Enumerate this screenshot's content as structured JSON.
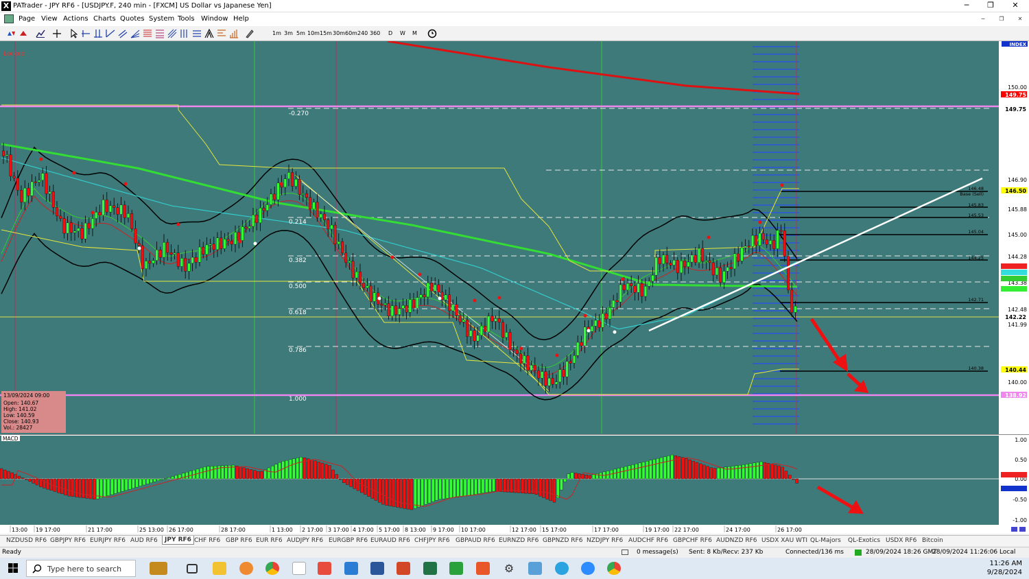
{
  "window": {
    "title": "PATrader - JPY RF6 - [USDJPY.F, 240 min - [FXCM] US Dollar vs Japanese Yen]",
    "minimize": "─",
    "maximize": "❐",
    "close": "✕"
  },
  "menu": {
    "items": [
      "Page",
      "View",
      "Actions",
      "Charts",
      "Quotes",
      "System",
      "Tools",
      "Window",
      "Help"
    ]
  },
  "toolbar": {
    "timeframes": [
      "1m",
      "3m",
      "5m",
      "10m",
      "15m",
      "30m",
      "60m",
      "240",
      "360",
      "D",
      "W",
      "M"
    ]
  },
  "chart": {
    "locked_label": "Locked",
    "index_badge": "INDEX",
    "info_box": {
      "date": "13/09/2024 09:00",
      "open": "Open: 140.67",
      "high": "High: 141.02",
      "low": "Low: 140.59",
      "close": "Close: 140.93",
      "vol": "Vol.: 28427"
    },
    "fib_labels": [
      "-0.270",
      "0.214",
      "0.382",
      "0.500",
      "0.618",
      "0.786",
      "1.000"
    ],
    "price_axis": [
      "150.00",
      "146.90",
      "145.88",
      "145.00",
      "144.28",
      "143.38",
      "142.48",
      "141.99",
      "140.00"
    ],
    "price_badges": [
      {
        "text": "149.75",
        "bg": "#ff0000",
        "fg": "#ffffff"
      },
      {
        "text": "149.75",
        "bg": "#ffffff",
        "fg": "#000000"
      },
      {
        "text": "146.50",
        "bg": "#ffff00",
        "fg": "#000000"
      },
      {
        "text": "142.22",
        "bg": "#ffffff",
        "fg": "#000000"
      },
      {
        "text": "140.44",
        "bg": "#ffff00",
        "fg": "#000000"
      },
      {
        "text": "138.92",
        "bg": "#ee88ee",
        "fg": "#ffffff"
      }
    ],
    "level_tags": [
      "146.48",
      "Base (Sell)",
      "145.83",
      "145.53",
      "145.04",
      "144.25",
      "142.71",
      "140.38"
    ],
    "macd_label": "MACD",
    "macd_axis": [
      "1.00",
      "0.50",
      "0.00",
      "-0.50",
      "-1.00"
    ],
    "time_axis": [
      "13:00",
      "19 17:00",
      "21 17:00",
      "25 13:00",
      "26 17:00",
      "28 17:00",
      "1 13:00",
      "2 17:00",
      "3 17:00",
      "4 17:00",
      "5 17:00",
      "8 13:00",
      "9 17:00",
      "10 17:00",
      "12 17:00",
      "15 17:00",
      "17 17:00",
      "19 17:00",
      "22 17:00",
      "24 17:00",
      "26 17:00"
    ]
  },
  "tabs": [
    "NZDUSD RF6",
    "GBPJPY RF6",
    "EURJPY RF6",
    "AUD RF6",
    "JPY RF6",
    "CHF RF6",
    "GBP RF6",
    "EUR RF6",
    "AUDJPY RF6",
    "EURGBP RF6",
    "EURAUD RF6",
    "CHFJPY RF6",
    "GBPAUD RF6",
    "EURNZD RF6",
    "GBPNZD RF6",
    "NZDJPY RF6",
    "AUDCHF RF6",
    "GBPCHF RF6",
    "AUDNZD RF6",
    "USDX XAU WTI",
    "QL-Majors",
    "QL-Exotics",
    "USDX RF6",
    "Bitcoin"
  ],
  "status": {
    "ready": "Ready",
    "messages": "0 message(s)",
    "traffic": "Sent: 8 Kb/Recv: 237 Kb",
    "connection": "Connected/136 ms",
    "gmt": "28/09/2024 18:26 GMT",
    "local": "28/09/2024 11:26:06 Local"
  },
  "taskbar": {
    "search_placeholder": "Type here to search",
    "time": "11:26 AM",
    "date": "9/28/2024"
  },
  "colors": {
    "chart_bg": "#3e7a7a",
    "bull": "#33ff33",
    "bear": "#ee1111",
    "ma_long": "#33dd33",
    "ma_red": "#dd1111"
  }
}
